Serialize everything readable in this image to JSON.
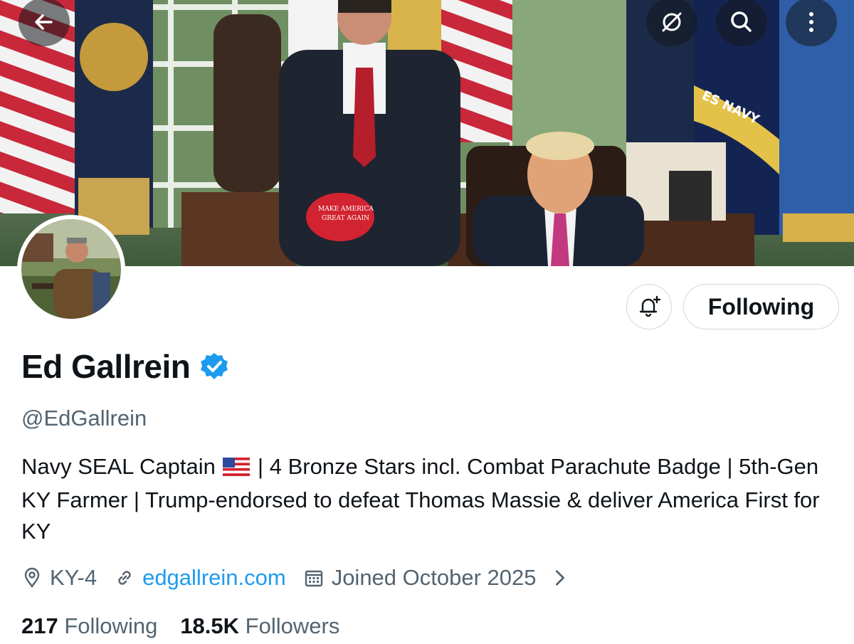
{
  "header": {
    "back_icon": "arrow-left-icon",
    "grok_icon": "grok-icon",
    "search_icon": "search-icon",
    "more_icon": "more-vertical-icon",
    "cap_text_line1": "MAKE AMERICA",
    "cap_text_line2": "GREAT AGAIN",
    "flag_text": "ES NAVY"
  },
  "profile": {
    "display_name": "Ed Gallrein",
    "handle": "@EdGallrein",
    "verified_color": "#1d9bf0",
    "bio_part1": "Navy SEAL Captain ",
    "bio_part2": " | 4 Bronze Stars incl. Combat Parachute Badge | 5th-Gen KY Farmer | Trump-endorsed to defeat Thomas Massie & deliver America First for KY",
    "location": "KY-4",
    "website": "edgallrein.com",
    "joined": "Joined October 2025"
  },
  "actions": {
    "notify_icon": "bell-plus-icon",
    "following_label": "Following"
  },
  "stats": {
    "following_count": "217",
    "following_label": "Following",
    "followers_count": "18.5K",
    "followers_label": "Followers"
  },
  "colors": {
    "accent": "#1d9bf0",
    "secondary_text": "#536471",
    "border": "#cfd9de"
  }
}
